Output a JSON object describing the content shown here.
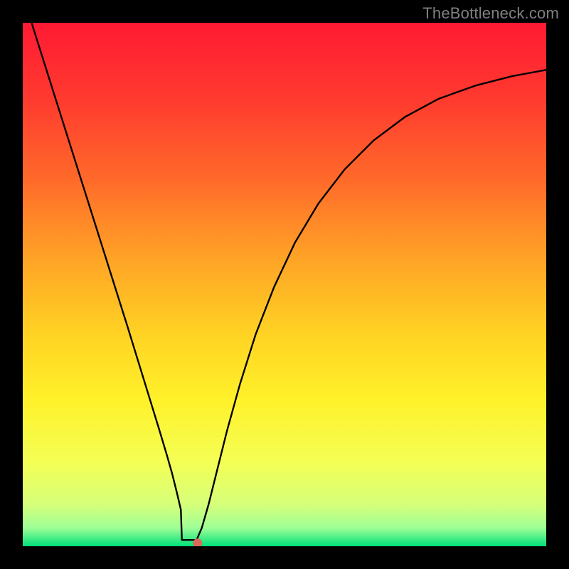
{
  "watermark": "TheBottleneck.com",
  "chart_data": {
    "type": "line",
    "title": "",
    "xlabel": "",
    "ylabel": "",
    "xlim": [
      0,
      100
    ],
    "ylim": [
      0,
      100
    ],
    "background_gradient": {
      "stops": [
        {
          "offset": 0.0,
          "color": "#ff1a33"
        },
        {
          "offset": 0.15,
          "color": "#ff3b2f"
        },
        {
          "offset": 0.3,
          "color": "#ff6a2a"
        },
        {
          "offset": 0.45,
          "color": "#ffa326"
        },
        {
          "offset": 0.6,
          "color": "#ffd423"
        },
        {
          "offset": 0.72,
          "color": "#fff12a"
        },
        {
          "offset": 0.84,
          "color": "#f4ff55"
        },
        {
          "offset": 0.92,
          "color": "#d6ff7a"
        },
        {
          "offset": 0.965,
          "color": "#9eff96"
        },
        {
          "offset": 1.0,
          "color": "#00e07a"
        }
      ]
    },
    "curve": {
      "x": [
        0,
        2,
        5,
        8,
        11,
        14,
        17,
        20,
        22,
        24,
        26,
        27.5,
        28.5,
        29.5,
        30.2,
        30.8,
        31.2,
        31.6,
        33.2,
        34.2,
        35.5,
        37,
        39,
        41.5,
        44.5,
        48,
        52,
        56.5,
        61.5,
        67,
        73,
        79.5,
        86.5,
        93.5,
        100
      ],
      "y": [
        106,
        99,
        89.5,
        80,
        70.5,
        61,
        51.5,
        42,
        35.5,
        29,
        22.5,
        17.5,
        14,
        10,
        7,
        4.2,
        2.5,
        1.2,
        1.2,
        3.5,
        8,
        14,
        22,
        31,
        40.5,
        49.5,
        58,
        65.5,
        72,
        77.5,
        82,
        85.5,
        88,
        89.8,
        91
      ]
    },
    "notch": {
      "x_start": 30.4,
      "x_end": 33.2,
      "y": 1.2
    },
    "marker": {
      "x": 33.4,
      "y": 0.6,
      "color": "#d86a5a",
      "radius": 6.5
    }
  }
}
